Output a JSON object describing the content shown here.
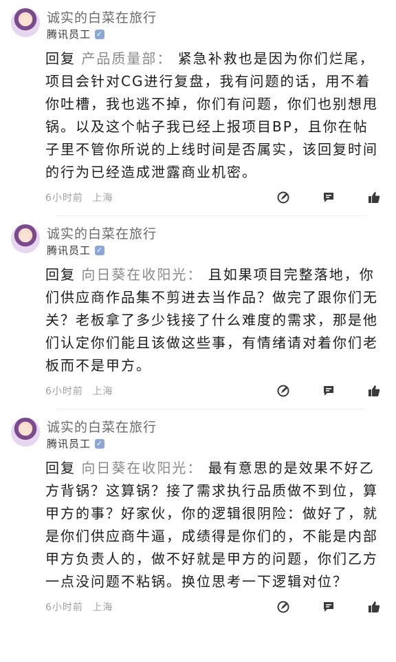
{
  "replies": [
    {
      "nickname": "诚实的白菜在旅行",
      "role": "腾讯员工",
      "reply_prefix": "回复",
      "reply_target": "产品质量部：",
      "text": "紧急补救也是因为你们烂尾，项目会针对CG进行复盘，我有问题的话，用不着你吐槽，我也逃不掉，你们有问题，你们也别想甩锅。以及这个帖子我已经上报项目BP，且你在帖子里不管你所说的上线时间是否属实，该回复时间的行为已经造成泄露商业机密。",
      "time": "6小时前",
      "location": "上海"
    },
    {
      "nickname": "诚实的白菜在旅行",
      "role": "腾讯员工",
      "reply_prefix": "回复",
      "reply_target": "向日葵在收阳光：",
      "text": "且如果项目完整落地，你们供应商作品集不剪进去当作品？做完了跟你们无关？老板拿了多少钱接了什么难度的需求，那是他们认定你们能且该做这些事，有情绪请对着你们老板而不是甲方。",
      "time": "6小时前",
      "location": "上海"
    },
    {
      "nickname": "诚实的白菜在旅行",
      "role": "腾讯员工",
      "reply_prefix": "回复",
      "reply_target": "向日葵在收阳光：",
      "text": "最有意思的是效果不好乙方背锅？这算锅？接了需求执行品质做不到位，算甲方的事？好家伙，你的逻辑很阴险：做好了，就是你们供应商牛逼，成绩得是你们的，不能是内部甲方负责人的，做不好就是甲方的问题，你们乙方一点没问题不粘锅。换位思考一下逻辑对位？",
      "time": "6小时前",
      "location": "上海"
    }
  ],
  "icons": {
    "verify": "verified-badge-icon",
    "edit": "compass-edit-icon",
    "comment": "comment-icon",
    "like": "thumbs-up-icon"
  },
  "colors": {
    "accent_verify": "#8aa7d6",
    "meta": "#a0a0a0",
    "icon": "#3a3a3a"
  }
}
